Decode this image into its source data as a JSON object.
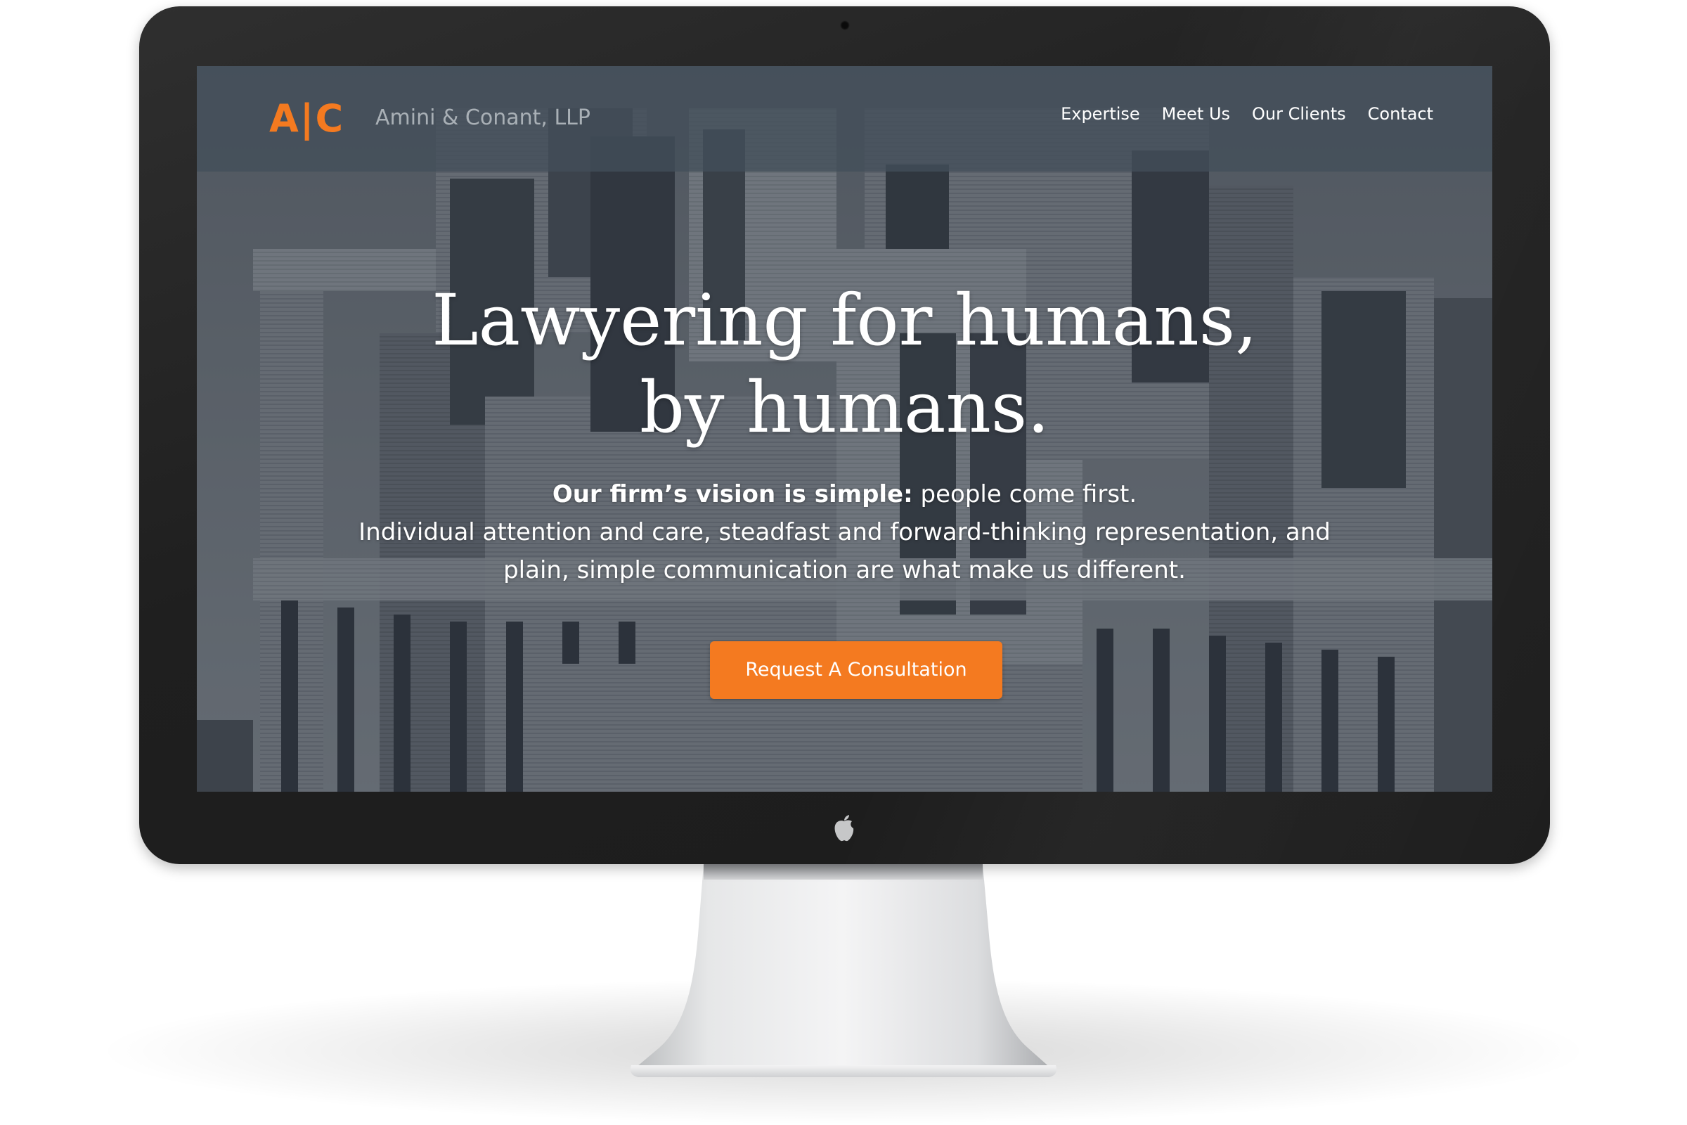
{
  "site": {
    "logo_text": "A|C",
    "brand_name": "Amini & Conant, LLP",
    "nav": [
      "Expertise",
      "Meet Us",
      "Our Clients",
      "Contact"
    ],
    "hero": {
      "headline_line1": "Lawyering for humans,",
      "headline_line2": "by humans.",
      "vision_bold": "Our firm’s vision is simple:",
      "vision_rest": " people come first.",
      "body_line1": "Individual attention and care, steadfast and forward-thinking representation, and",
      "body_line2": "plain, simple communication are what make us different.",
      "cta_label": "Request A Consultation"
    }
  },
  "colors": {
    "accent": "#f47a20",
    "nav_bg": "#424e5a",
    "bezel": "#222222",
    "text": "#ffffff"
  },
  "icons": [
    "camera-dot",
    "apple-icon"
  ]
}
